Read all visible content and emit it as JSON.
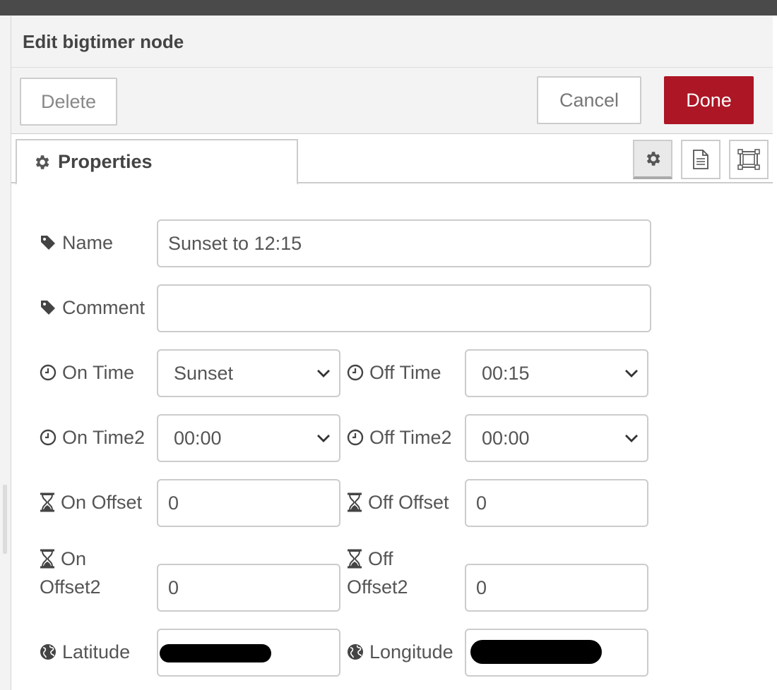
{
  "title": "Edit bigtimer node",
  "toolbar": {
    "delete": "Delete",
    "cancel": "Cancel",
    "done": "Done"
  },
  "tabs": {
    "properties": "Properties",
    "icons": [
      "gear-icon",
      "document-icon",
      "frame-icon"
    ]
  },
  "form": {
    "name": {
      "label": "Name",
      "value": "Sunset to 12:15"
    },
    "comment": {
      "label": "Comment",
      "value": ""
    },
    "on_time": {
      "label": "On Time",
      "value": "Sunset"
    },
    "off_time": {
      "label": "Off Time",
      "value": "00:15"
    },
    "on_time2": {
      "label": "On Time2",
      "value": "00:00"
    },
    "off_time2": {
      "label": "Off Time2",
      "value": "00:00"
    },
    "on_offset": {
      "label": "On Offset",
      "value": "0"
    },
    "off_offset": {
      "label": "Off Offset",
      "value": "0"
    },
    "on_offset2": {
      "label_line1": "On",
      "label_line2": "Offset2",
      "value": "0"
    },
    "off_offset2": {
      "label_line1": "Off",
      "label_line2": "Offset2",
      "value": "0"
    },
    "latitude": {
      "label": "Latitude"
    },
    "longitude": {
      "label": "Longitude"
    }
  },
  "colors": {
    "done_button": "#ad1625",
    "topbar": "#4a4a4a"
  }
}
